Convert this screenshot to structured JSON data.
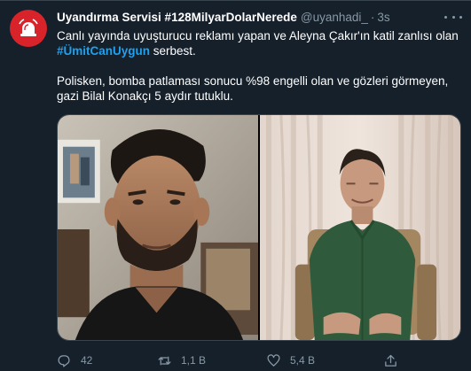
{
  "tweet": {
    "author_name": "Uyandırma Servisi #128MilyarDolarNerede",
    "author_handle": "@uyanhadi_",
    "separator": "·",
    "time": "3s",
    "line1": "Canlı yayında uyuşturucu reklamı yapan ve Aleyna Çakır'ın katil zanlısı olan",
    "hashtag": "#ÜmitCanUygun",
    "line2_rest": " serbest.",
    "line3": "Polisken, bomba patlaması sonucu %98 engelli olan ve gözleri görmeyen,",
    "line4": "gazi Bilal Konakçı 5 aydır tutuklu."
  },
  "actions": {
    "reply_count": "42",
    "retweet_count": "1,1 B",
    "like_count": "5,4 B"
  },
  "icons": {
    "avatar": "alarm-bell-icon",
    "more": "more-icon",
    "reply": "reply-icon",
    "retweet": "retweet-icon",
    "like": "heart-icon",
    "share": "share-icon"
  },
  "colors": {
    "background": "#15202b",
    "accent": "#1da1f2",
    "muted": "#8899a6",
    "avatar": "#d8232a"
  }
}
